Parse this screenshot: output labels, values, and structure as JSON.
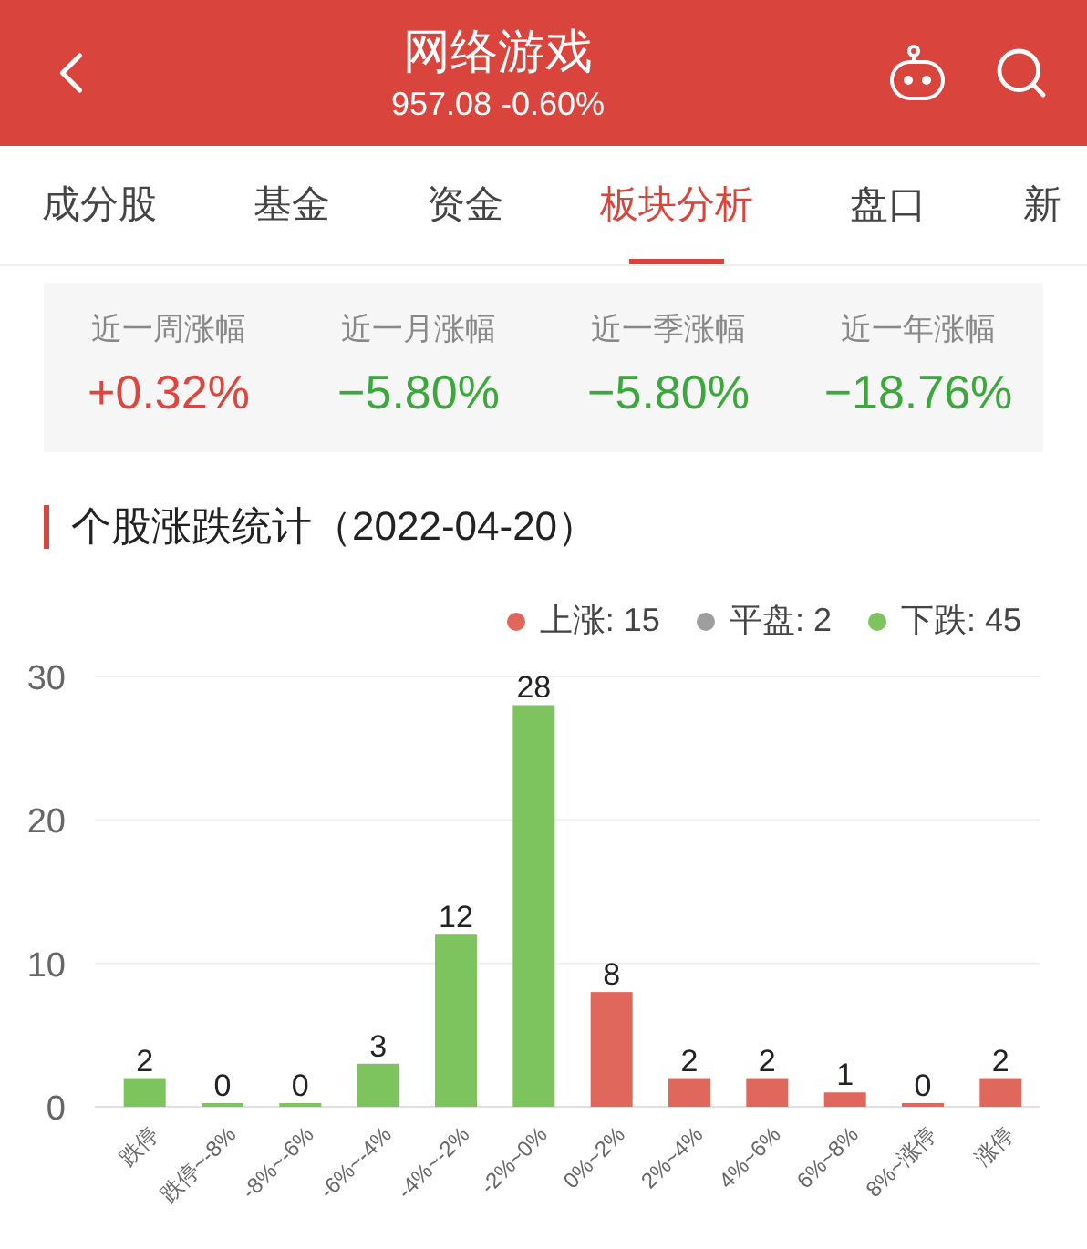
{
  "header": {
    "title": "网络游戏",
    "subtitle": "957.08 -0.60%"
  },
  "tabs": [
    {
      "label": "成分股",
      "selected": false
    },
    {
      "label": "基金",
      "selected": false
    },
    {
      "label": "资金",
      "selected": false
    },
    {
      "label": "板块分析",
      "selected": true
    },
    {
      "label": "盘口",
      "selected": false
    },
    {
      "label": "新",
      "selected": false
    }
  ],
  "stats": [
    {
      "label": "近一周涨幅",
      "value": "+0.32%",
      "kind": "up"
    },
    {
      "label": "近一月涨幅",
      "value": "−5.80%",
      "kind": "down"
    },
    {
      "label": "近一季涨幅",
      "value": "−5.80%",
      "kind": "down"
    },
    {
      "label": "近一年涨幅",
      "value": "−18.76%",
      "kind": "down"
    }
  ],
  "section": {
    "title": "个股涨跌统计（2022-04-20）",
    "legend": [
      {
        "label": "上涨: 15",
        "color": "#e0675b"
      },
      {
        "label": "平盘: 2",
        "color": "#9e9e9e"
      },
      {
        "label": "下跌: 45",
        "color": "#7dc45f"
      }
    ],
    "chart_data": {
      "type": "bar",
      "categories": [
        "跌停",
        "跌停~-8%",
        "-8%~-6%",
        "-6%~-4%",
        "-4%~-2%",
        "-2%~0%",
        "0%~2%",
        "2%~4%",
        "4%~6%",
        "6%~8%",
        "8%~涨停",
        "涨停"
      ],
      "series": [
        {
          "color": "#7dc45f",
          "values": [
            2,
            0,
            0,
            3,
            12,
            28,
            null,
            null,
            null,
            null,
            null,
            null
          ]
        },
        {
          "color": "#e0675b",
          "values": [
            null,
            null,
            null,
            null,
            null,
            null,
            8,
            2,
            2,
            1,
            0,
            2
          ]
        }
      ],
      "ylim": [
        0,
        30
      ],
      "yticks": [
        0,
        10,
        20,
        30
      ],
      "stacked": true,
      "data_labels": true
    }
  }
}
